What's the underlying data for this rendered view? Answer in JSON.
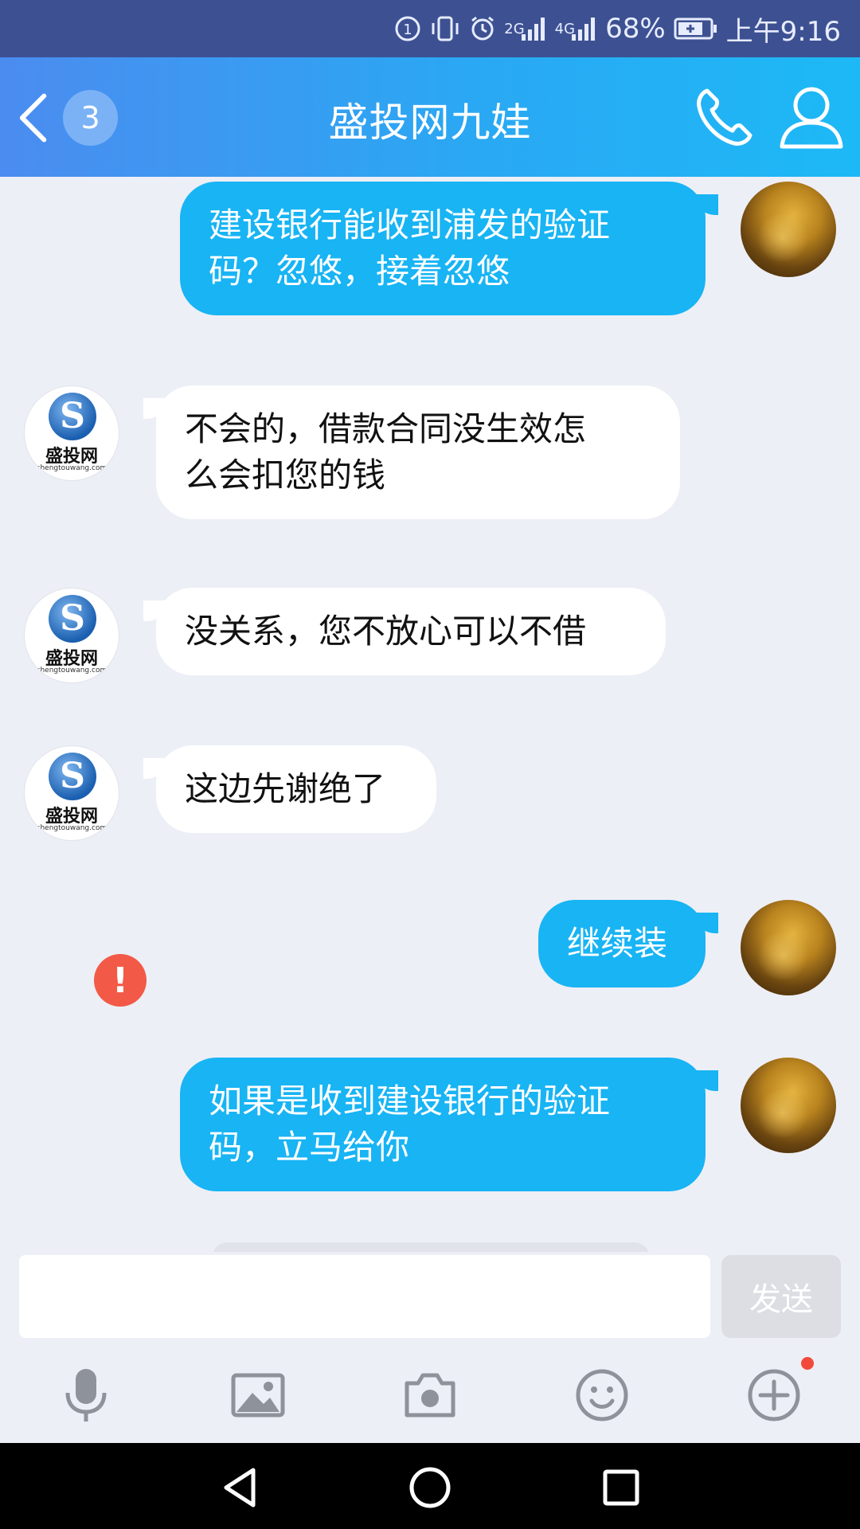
{
  "status_bar": {
    "sim_label": "1",
    "net_2g": "2G",
    "net_4g": "4G",
    "battery": "68%",
    "time": "上午9:16"
  },
  "header": {
    "unread_count": "3",
    "title": "盛投网九娃",
    "icons": [
      "back-arrow-icon",
      "phone-icon",
      "person-icon"
    ]
  },
  "contact_logo": {
    "text": "盛投网",
    "url": "shengtouwang.com"
  },
  "messages": [
    {
      "side": "out",
      "text_lines": [
        "建设银行能收到浦发的验证",
        "码？忽悠，接着忽悠"
      ]
    },
    {
      "side": "in",
      "text_lines": [
        "不会的，借款合同没生效怎",
        "么会扣您的钱"
      ]
    },
    {
      "side": "in",
      "text_lines": [
        "没关系，您不放心可以不借"
      ]
    },
    {
      "side": "in",
      "text_lines": [
        "这边先谢绝了"
      ]
    },
    {
      "side": "out",
      "text_lines": [
        "继续装"
      ]
    },
    {
      "side": "out",
      "text_lines": [
        "如果是收到建设银行的验证",
        "码，立马给你"
      ],
      "failed": true,
      "error_mark": "!"
    }
  ],
  "input": {
    "value": "",
    "send_label": "发送"
  },
  "toolbar": {
    "icons": [
      "microphone-icon",
      "image-icon",
      "camera-icon",
      "emoji-icon",
      "plus-icon"
    ],
    "plus_has_notification": true
  },
  "colors": {
    "outgoing_bubble": "#18b4f4",
    "incoming_bubble": "#ffffff",
    "chat_background": "#edeff6",
    "error": "#f25a47"
  }
}
